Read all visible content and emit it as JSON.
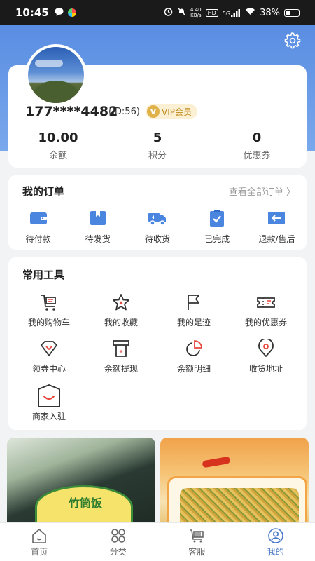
{
  "status_bar": {
    "time": "10:45",
    "net_speed_value": "4.40",
    "net_speed_unit": "KB/s",
    "hd": "HD",
    "signal": "5G",
    "battery": "38%"
  },
  "profile": {
    "phone": "177****4482",
    "id_text": "(ID:56)",
    "vip_badge": "VIP会员",
    "stats": [
      {
        "value": "10.00",
        "label": "余额"
      },
      {
        "value": "5",
        "label": "积分"
      },
      {
        "value": "0",
        "label": "优惠券"
      }
    ]
  },
  "orders": {
    "title": "我的订单",
    "view_all": "查看全部订单 〉",
    "items": [
      {
        "label": "待付款",
        "icon": "wallet-icon"
      },
      {
        "label": "待发货",
        "icon": "box-icon"
      },
      {
        "label": "待收货",
        "icon": "truck-icon"
      },
      {
        "label": "已完成",
        "icon": "clipboard-check-icon"
      },
      {
        "label": "退款/售后",
        "icon": "return-icon"
      }
    ]
  },
  "tools": {
    "title": "常用工具",
    "items": [
      {
        "label": "我的购物车",
        "icon": "cart-icon"
      },
      {
        "label": "我的收藏",
        "icon": "star-icon"
      },
      {
        "label": "我的足迹",
        "icon": "flag-icon"
      },
      {
        "label": "我的优惠券",
        "icon": "ticket-icon"
      },
      {
        "label": "领券中心",
        "icon": "gem-icon"
      },
      {
        "label": "余额提现",
        "icon": "withdraw-icon"
      },
      {
        "label": "余额明细",
        "icon": "pie-chart-icon"
      },
      {
        "label": "收货地址",
        "icon": "location-icon"
      },
      {
        "label": "商家入驻",
        "icon": "shop-icon"
      }
    ]
  },
  "products": [
    {
      "label_text": "竹筒饭"
    },
    {
      "label_text": ""
    }
  ],
  "tabbar": {
    "items": [
      {
        "label": "首页",
        "icon": "home-icon"
      },
      {
        "label": "分类",
        "icon": "grid-icon"
      },
      {
        "label": "客服",
        "icon": "service-cart-icon"
      },
      {
        "label": "我的",
        "icon": "user-icon"
      }
    ],
    "active_index": 3
  },
  "colors": {
    "brand_blue": "#5a8de2",
    "accent_red": "#e8473e",
    "vip_gold": "#c28a1a",
    "active_tab": "#4a78c8"
  }
}
